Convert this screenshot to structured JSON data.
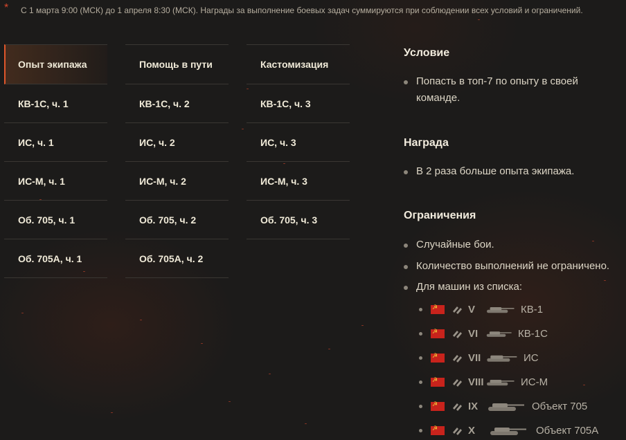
{
  "notice": "С 1 марта 9:00 (МСК) до 1 апреля 8:30 (МСК). Награды за выполнение боевых задач суммируются при соблюдении всех условий и ограничений.",
  "columns": [
    [
      "Опыт экипажа",
      "КВ-1С, ч. 1",
      "ИС, ч. 1",
      "ИС-М, ч. 1",
      "Об. 705, ч. 1",
      "Об. 705А, ч. 1"
    ],
    [
      "Помощь в пути",
      "КВ-1С, ч. 2",
      "ИС, ч. 2",
      "ИС-М, ч. 2",
      "Об. 705, ч. 2",
      "Об. 705А, ч. 2"
    ],
    [
      "Кастомизация",
      "КВ-1С, ч. 3",
      "ИС, ч. 3",
      "ИС-М, ч. 3",
      "Об. 705, ч. 3"
    ]
  ],
  "condition": {
    "title": "Условие",
    "text": "Попасть в топ-7 по опыту в своей команде."
  },
  "reward": {
    "title": "Награда",
    "text": "В 2 раза больше опыта экипажа."
  },
  "restrictions": {
    "title": "Ограничения",
    "items": [
      "Случайные бои.",
      "Количество выполнений не ограничено.",
      "Для машин из списка:"
    ]
  },
  "vehicles": [
    {
      "tier": "V",
      "name": "КВ-1",
      "icon": "heavy-tank-icon"
    },
    {
      "tier": "VI",
      "name": "КВ-1С",
      "icon": "heavy-tank-icon"
    },
    {
      "tier": "VII",
      "name": "ИС",
      "icon": "heavy-tank-icon"
    },
    {
      "tier": "VIII",
      "name": "ИС-М",
      "icon": "heavy-tank-icon"
    },
    {
      "tier": "IX",
      "name": "Объект 705",
      "icon": "heavy-tank-icon"
    },
    {
      "tier": "X",
      "name": "Объект 705А",
      "icon": "heavy-tank-icon"
    }
  ],
  "colors": {
    "accent": "#e0562b",
    "flag": "#c8231c",
    "background": "#1c1b1a"
  }
}
